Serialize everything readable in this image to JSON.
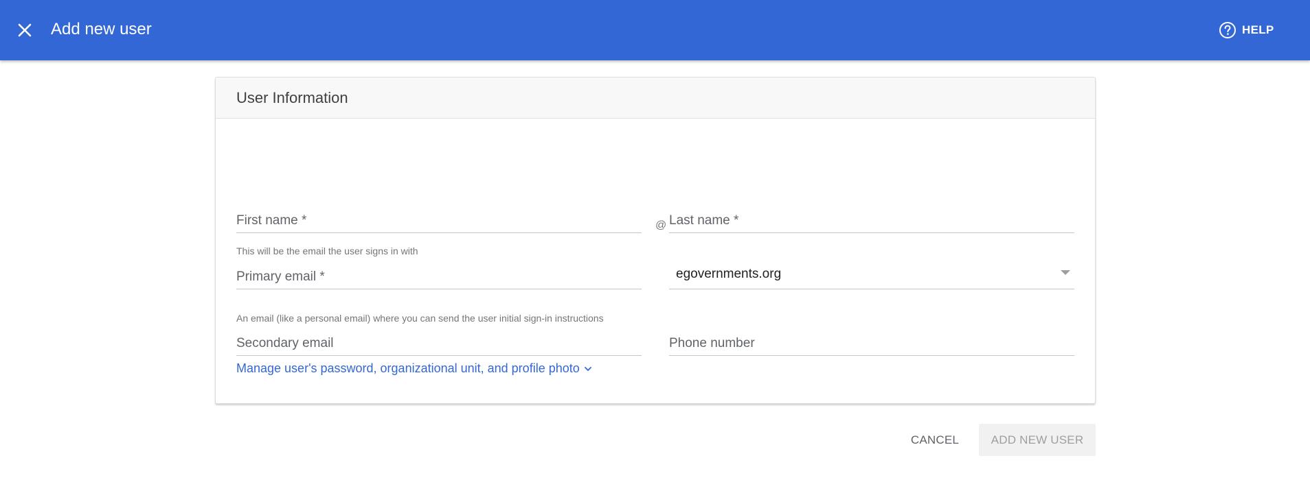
{
  "appbar": {
    "title": "Add new user",
    "close_icon": "close-icon",
    "help_label": "HELP",
    "help_icon": "help-circle-icon",
    "background": "#3367d6"
  },
  "card": {
    "title": "User Information",
    "fields": {
      "first_name": {
        "label": "First name *"
      },
      "last_name": {
        "label": "Last name *"
      },
      "primary_email": {
        "label": "Primary email *",
        "hint": "This will be the email the user signs in with"
      },
      "at_sign": "@",
      "domain": {
        "value": "egovernments.org",
        "icon": "dropdown-caret-icon"
      },
      "secondary_email": {
        "label": "Secondary email",
        "hint": "An email (like a personal email) where you can send the user initial sign-in instructions"
      },
      "phone": {
        "label": "Phone number"
      }
    },
    "manage_link": {
      "label": "Manage user's password, organizational unit, and profile photo",
      "icon": "chevron-down-icon",
      "color": "#3367d6"
    }
  },
  "footer": {
    "cancel_label": "CANCEL",
    "add_label": "ADD NEW USER",
    "add_disabled": true
  }
}
